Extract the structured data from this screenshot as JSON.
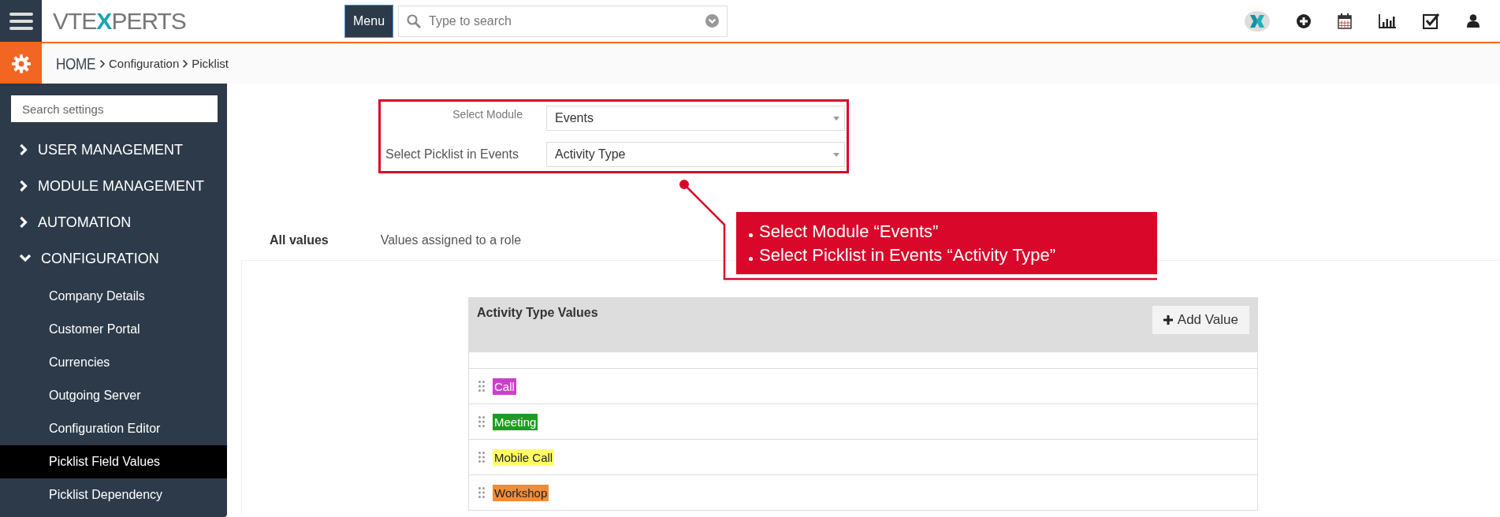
{
  "header": {
    "logo": [
      "VTE",
      "X",
      "PERTS"
    ],
    "menu_button": "Menu",
    "search": {
      "placeholder": "Type to search"
    }
  },
  "breadcrumb": [
    "HOME",
    "Configuration",
    "Picklist"
  ],
  "sidebar": {
    "search": {
      "placeholder": "Search settings"
    },
    "sections": [
      {
        "label": "USER MANAGEMENT",
        "expanded": false
      },
      {
        "label": "MODULE MANAGEMENT",
        "expanded": false
      },
      {
        "label": "AUTOMATION",
        "expanded": false
      },
      {
        "label": "CONFIGURATION",
        "expanded": true,
        "children": [
          {
            "label": "Company Details",
            "selected": false
          },
          {
            "label": "Customer Portal",
            "selected": false
          },
          {
            "label": "Currencies",
            "selected": false
          },
          {
            "label": "Outgoing Server",
            "selected": false
          },
          {
            "label": "Configuration Editor",
            "selected": false
          },
          {
            "label": "Picklist Field Values",
            "selected": true
          },
          {
            "label": "Picklist Dependency",
            "selected": false
          }
        ]
      }
    ]
  },
  "form": {
    "fields": [
      {
        "label": "Select Module",
        "value": "Events"
      },
      {
        "label": "Select Picklist in Events",
        "value": "Activity Type"
      }
    ]
  },
  "callout": {
    "lines": [
      "Select Module “Events”",
      "Select Picklist in Events “Activity Type”"
    ]
  },
  "tabs": [
    {
      "label": "All values",
      "selected": true
    },
    {
      "label": "Values assigned to a role",
      "selected": false
    }
  ],
  "values_table": {
    "title": "Activity Type Values",
    "add_button": "Add Value",
    "rows": [
      {
        "label": "Call",
        "color": "#cc3fcc"
      },
      {
        "label": "Meeting",
        "color": "#1f9a22"
      },
      {
        "label": "Mobile Call",
        "color": "#ffff66"
      },
      {
        "label": "Workshop",
        "color": "#ef8d3a"
      }
    ]
  }
}
